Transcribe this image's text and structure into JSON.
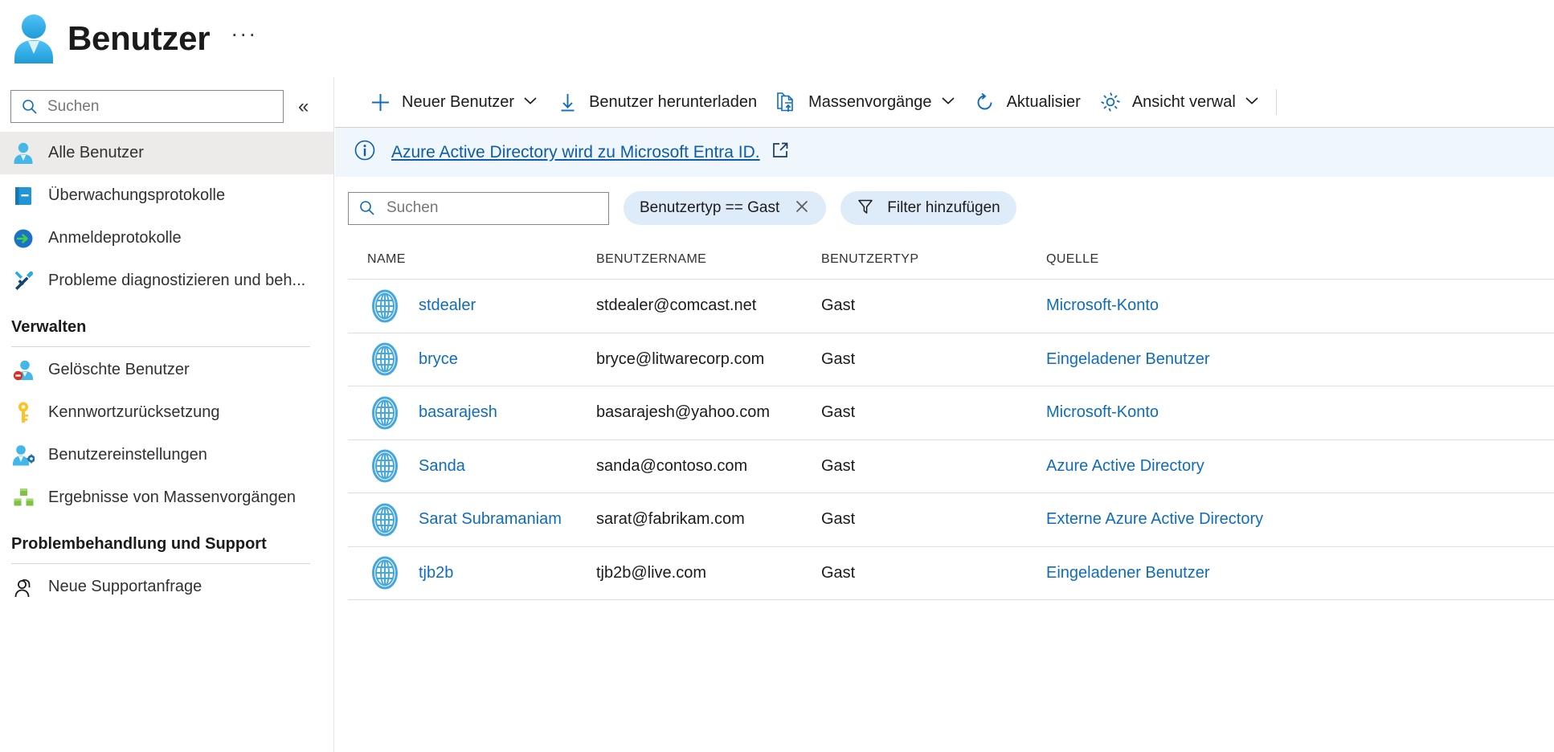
{
  "header": {
    "title": "Benutzer",
    "more_label": "···",
    "icon": "user-icon"
  },
  "sidebar": {
    "search": {
      "placeholder": "Suchen",
      "value": "",
      "icon": "search-icon"
    },
    "collapse": {
      "label": "«",
      "icon": "double-chevron-left-icon"
    },
    "items": [
      {
        "label": "Alle Benutzer",
        "icon": "user-icon",
        "selected": true
      },
      {
        "label": "Überwachungsprotokolle",
        "icon": "audit-log-icon",
        "selected": false
      },
      {
        "label": "Anmeldeprotokolle",
        "icon": "sign-in-icon",
        "selected": false
      },
      {
        "label": "Probleme diagnostizieren und beh...",
        "icon": "troubleshoot-icon",
        "selected": false
      }
    ],
    "groups": [
      {
        "title": "Verwalten",
        "items": [
          {
            "label": "Gelöschte Benutzer",
            "icon": "deleted-user-icon"
          },
          {
            "label": "Kennwortzurücksetzung",
            "icon": "key-icon"
          },
          {
            "label": "Benutzereinstellungen",
            "icon": "user-settings-icon"
          },
          {
            "label": "Ergebnisse von Massenvorgängen",
            "icon": "bulk-results-icon"
          }
        ]
      },
      {
        "title": "Problembehandlung und Support",
        "items": [
          {
            "label": "Neue Supportanfrage",
            "icon": "support-request-icon"
          }
        ]
      }
    ]
  },
  "toolbar": {
    "items": [
      {
        "label": "Neuer Benutzer",
        "icon": "plus-icon",
        "caret": true
      },
      {
        "label": "Benutzer herunterladen",
        "icon": "download-icon",
        "caret": false
      },
      {
        "label": "Massenvorgänge",
        "icon": "bulk-operations-icon",
        "caret": true
      },
      {
        "label": "Aktualisier",
        "icon": "refresh-icon",
        "caret": false
      },
      {
        "label": "Ansicht verwal",
        "icon": "gear-icon",
        "caret": true
      }
    ]
  },
  "banner": {
    "icon": "info-icon",
    "link_text": "Azure Active Directory wird zu Microsoft Entra ID.",
    "external_icon": "external-link-icon"
  },
  "filters": {
    "search": {
      "placeholder": "Suchen",
      "value": "",
      "icon": "search-icon"
    },
    "active_filter": {
      "label": "Benutzertyp == Gast",
      "remove_icon": "close-icon"
    },
    "add_filter": {
      "label": "Filter hinzufügen",
      "icon": "funnel-icon"
    }
  },
  "table": {
    "columns": [
      "NAME",
      "BENUTZERNAME",
      "BENUTZERTYP",
      "QUELLE"
    ],
    "rows": [
      {
        "icon": "globe-icon",
        "name": "stdealer",
        "username": "stdealer@comcast.net",
        "usertype": "Gast",
        "source": "Microsoft-Konto"
      },
      {
        "icon": "globe-icon",
        "name": "bryce",
        "username": "bryce@litwarecorp.com",
        "usertype": "Gast",
        "source": "Eingeladener Benutzer"
      },
      {
        "icon": "globe-icon",
        "name": "basarajesh",
        "username": "basarajesh@yahoo.com",
        "usertype": "Gast",
        "source": "Microsoft-Konto"
      },
      {
        "icon": "globe-icon",
        "name": "Sanda",
        "username": "sanda@contoso.com",
        "usertype": "Gast",
        "source": "Azure Active Directory"
      },
      {
        "icon": "globe-icon",
        "name": "Sarat Subramaniam",
        "username": "sarat@fabrikam.com",
        "usertype": "Gast",
        "source": "Externe Azure Active Directory"
      },
      {
        "icon": "globe-icon",
        "name": "tjb2b",
        "username": "tjb2b@live.com",
        "usertype": "Gast",
        "source": "Eingeladener Benutzer"
      }
    ]
  },
  "colors": {
    "link": "#0f6cbd",
    "banner_bg": "#eff6fc",
    "pill_bg": "#deecf9",
    "accent": "#0078d4",
    "selected_bg": "#edebe9"
  }
}
